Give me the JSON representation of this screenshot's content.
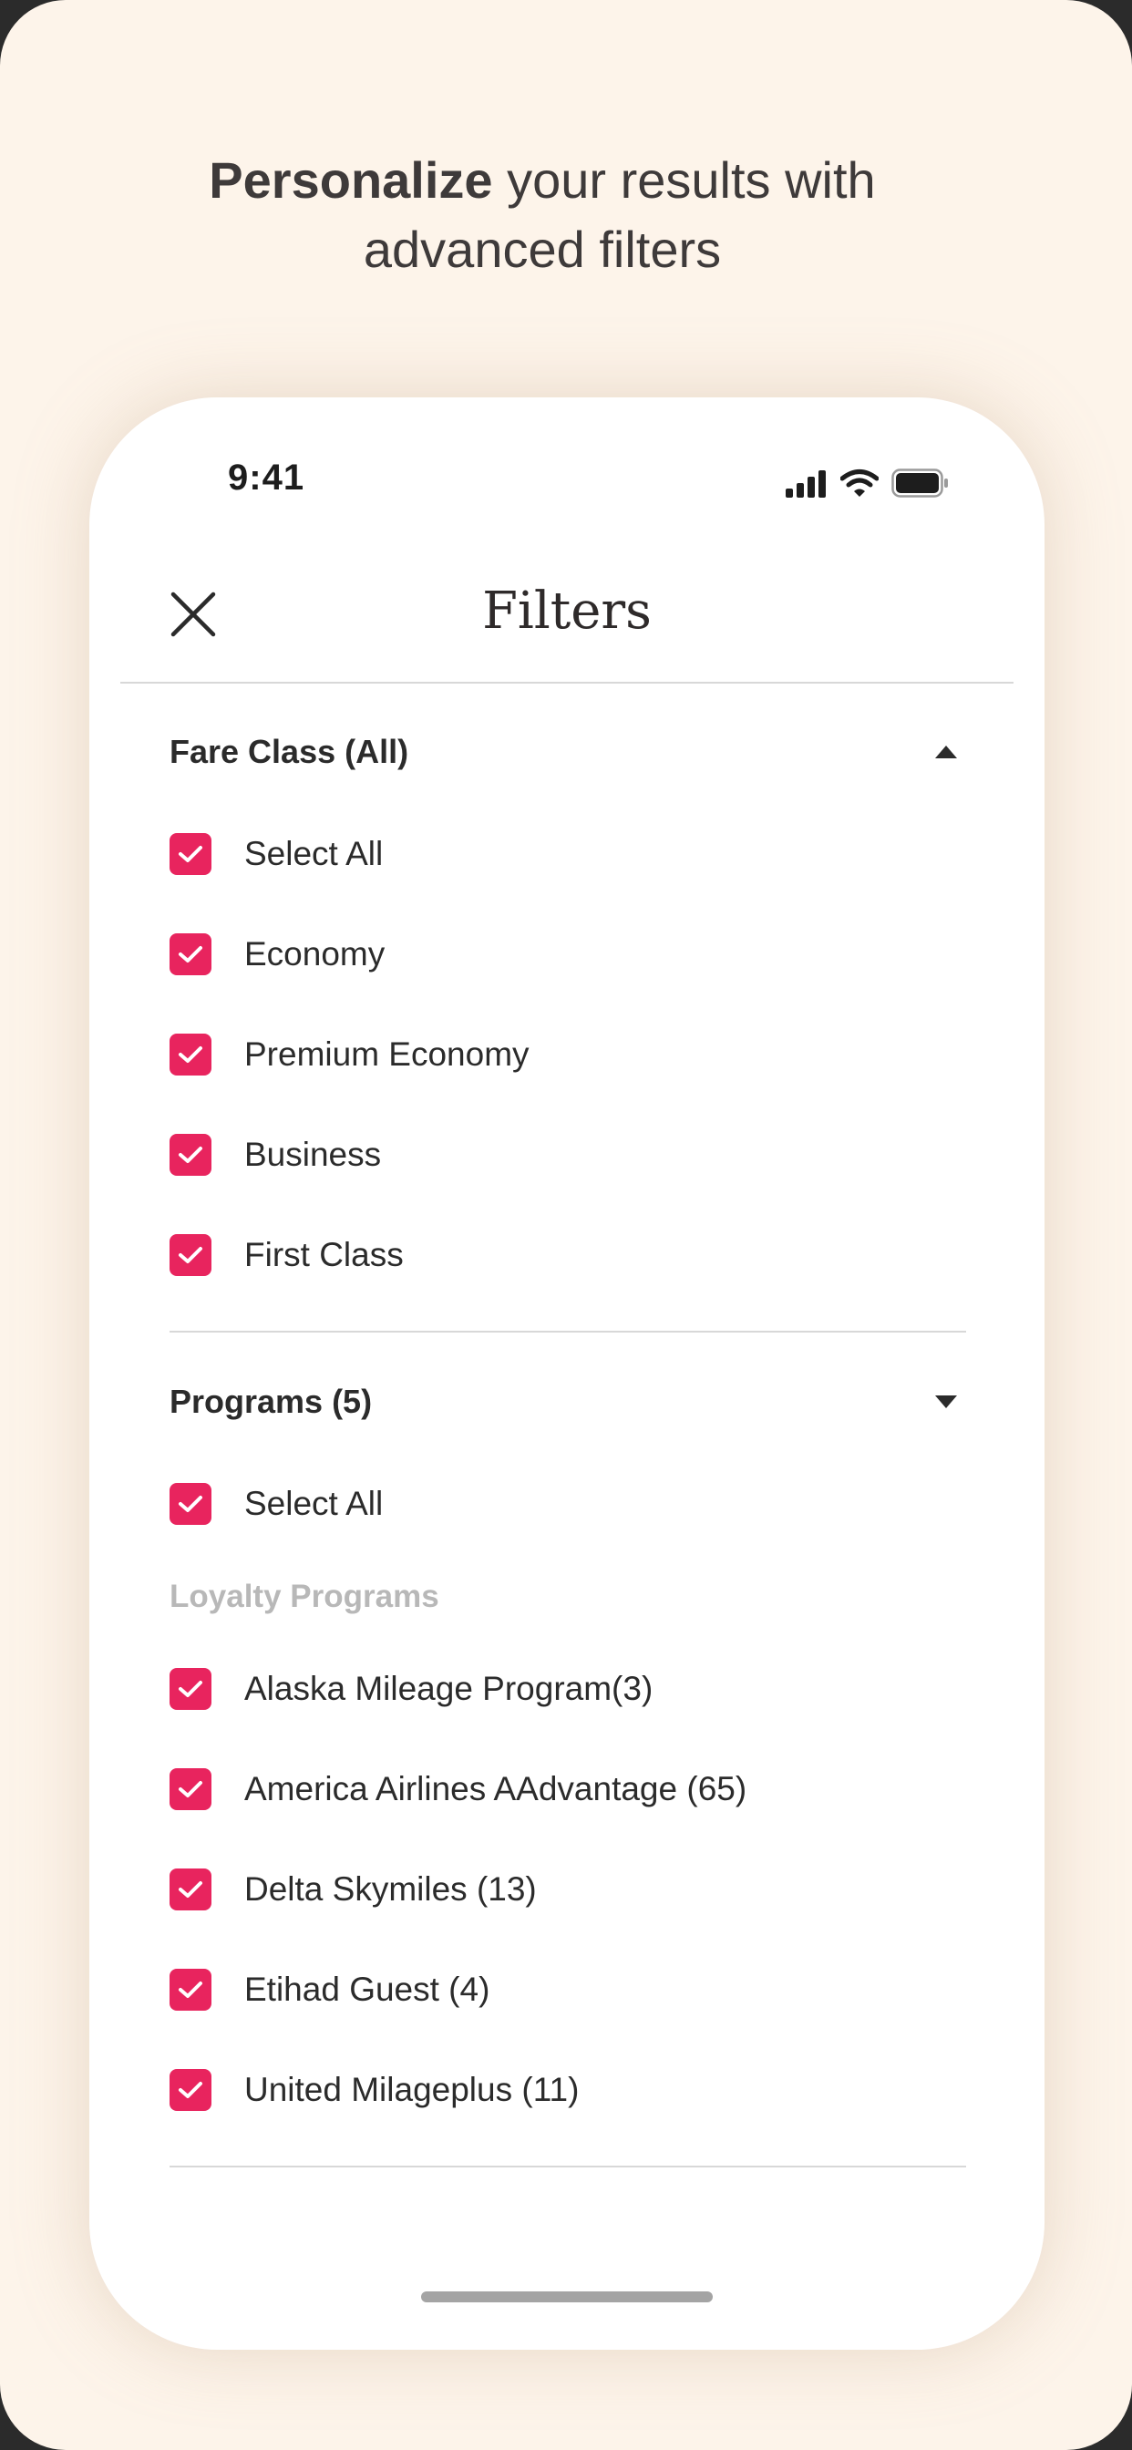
{
  "headline": {
    "bold": "Personalize",
    "rest_line1": " your results with",
    "line2": "advanced filters"
  },
  "status_bar": {
    "time": "9:41",
    "icons": [
      "cellular-signal-icon",
      "wifi-icon",
      "battery-icon"
    ]
  },
  "nav": {
    "close_icon": "close-icon",
    "title": "Filters"
  },
  "fare_class": {
    "title": "Fare Class (All)",
    "expanded_icon": "caret-up-icon",
    "options": [
      {
        "label": "Select All",
        "checked": true
      },
      {
        "label": "Economy",
        "checked": true
      },
      {
        "label": "Premium Economy",
        "checked": true
      },
      {
        "label": "Business",
        "checked": true
      },
      {
        "label": "First Class",
        "checked": true
      }
    ]
  },
  "programs": {
    "title": "Programs (5)",
    "expanded_icon": "caret-down-icon",
    "select_all": {
      "label": "Select All",
      "checked": true
    },
    "subheading": "Loyalty Programs",
    "options": [
      {
        "label": "Alaska Mileage Program(3)",
        "checked": true
      },
      {
        "label": "America Airlines AAdvantage (65)",
        "checked": true
      },
      {
        "label": "Delta Skymiles (13)",
        "checked": true
      },
      {
        "label": "Etihad Guest (4)",
        "checked": true
      },
      {
        "label": "United Milageplus (11)",
        "checked": true
      }
    ]
  },
  "colors": {
    "accent": "#e8245e",
    "background": "#fdf4ea",
    "text": "#2b2b2b",
    "muted": "#b8b8b8"
  }
}
